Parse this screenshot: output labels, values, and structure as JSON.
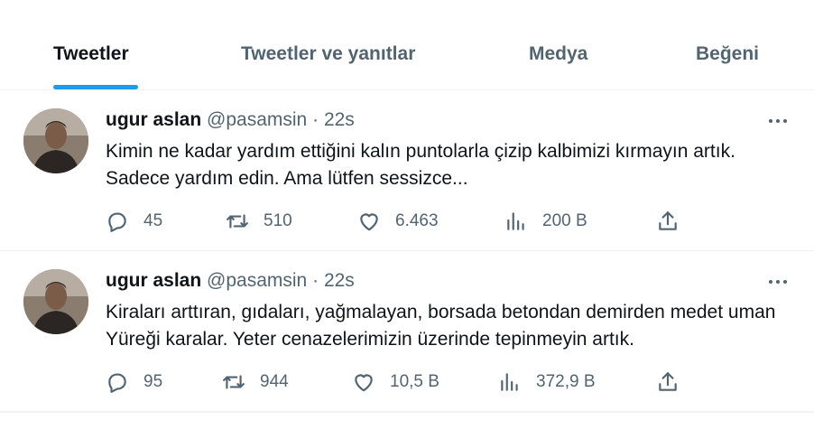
{
  "tabs": [
    {
      "label": "Tweetler",
      "active": true
    },
    {
      "label": "Tweetler ve yanıtlar",
      "active": false
    },
    {
      "label": "Medya",
      "active": false
    },
    {
      "label": "Beğeni",
      "active": false
    }
  ],
  "tweets": [
    {
      "author_name": "ugur aslan",
      "handle": "@pasamsin",
      "separator": "·",
      "time": "22s",
      "text": "Kimin ne kadar yardım ettiğini kalın puntolarla çizip kalbimizi kırmayın artık. Sadece yardım edin. Ama lütfen sessizce...",
      "replies": "45",
      "retweets": "510",
      "likes": "6.463",
      "views": "200 B"
    },
    {
      "author_name": "ugur aslan",
      "handle": "@pasamsin",
      "separator": "·",
      "time": "22s",
      "text": "Kiraları arttıran, gıdaları, yağmalayan, borsada betondan demirden medet uman Yüreği karalar. Yeter cenazelerimizin üzerinde tepinmeyin artık.",
      "replies": "95",
      "retweets": "944",
      "likes": "10,5 B",
      "views": "372,9 B"
    }
  ],
  "icons": {
    "reply": "reply-icon",
    "retweet": "retweet-icon",
    "like": "heart-icon",
    "views": "views-bar-chart-icon",
    "share": "share-icon",
    "more": "more-dots-icon"
  },
  "colors": {
    "accent": "#1d9bf0",
    "text_primary": "#0f1419",
    "text_secondary": "#536471",
    "divider": "#eff3f4"
  }
}
